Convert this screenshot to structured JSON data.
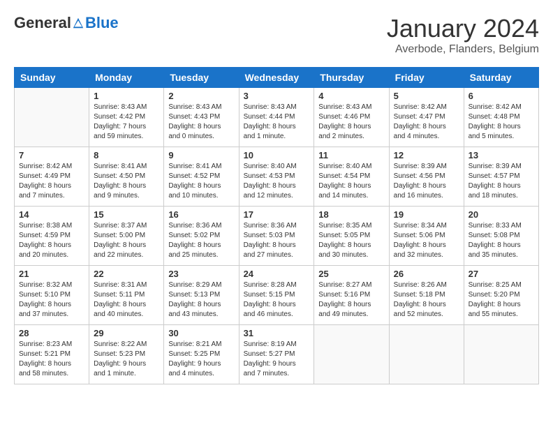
{
  "logo": {
    "general": "General",
    "blue": "Blue"
  },
  "header": {
    "month": "January 2024",
    "location": "Averbode, Flanders, Belgium"
  },
  "weekdays": [
    "Sunday",
    "Monday",
    "Tuesday",
    "Wednesday",
    "Thursday",
    "Friday",
    "Saturday"
  ],
  "weeks": [
    [
      {
        "day": "",
        "info": ""
      },
      {
        "day": "1",
        "info": "Sunrise: 8:43 AM\nSunset: 4:42 PM\nDaylight: 7 hours\nand 59 minutes."
      },
      {
        "day": "2",
        "info": "Sunrise: 8:43 AM\nSunset: 4:43 PM\nDaylight: 8 hours\nand 0 minutes."
      },
      {
        "day": "3",
        "info": "Sunrise: 8:43 AM\nSunset: 4:44 PM\nDaylight: 8 hours\nand 1 minute."
      },
      {
        "day": "4",
        "info": "Sunrise: 8:43 AM\nSunset: 4:46 PM\nDaylight: 8 hours\nand 2 minutes."
      },
      {
        "day": "5",
        "info": "Sunrise: 8:42 AM\nSunset: 4:47 PM\nDaylight: 8 hours\nand 4 minutes."
      },
      {
        "day": "6",
        "info": "Sunrise: 8:42 AM\nSunset: 4:48 PM\nDaylight: 8 hours\nand 5 minutes."
      }
    ],
    [
      {
        "day": "7",
        "info": "Sunrise: 8:42 AM\nSunset: 4:49 PM\nDaylight: 8 hours\nand 7 minutes."
      },
      {
        "day": "8",
        "info": "Sunrise: 8:41 AM\nSunset: 4:50 PM\nDaylight: 8 hours\nand 9 minutes."
      },
      {
        "day": "9",
        "info": "Sunrise: 8:41 AM\nSunset: 4:52 PM\nDaylight: 8 hours\nand 10 minutes."
      },
      {
        "day": "10",
        "info": "Sunrise: 8:40 AM\nSunset: 4:53 PM\nDaylight: 8 hours\nand 12 minutes."
      },
      {
        "day": "11",
        "info": "Sunrise: 8:40 AM\nSunset: 4:54 PM\nDaylight: 8 hours\nand 14 minutes."
      },
      {
        "day": "12",
        "info": "Sunrise: 8:39 AM\nSunset: 4:56 PM\nDaylight: 8 hours\nand 16 minutes."
      },
      {
        "day": "13",
        "info": "Sunrise: 8:39 AM\nSunset: 4:57 PM\nDaylight: 8 hours\nand 18 minutes."
      }
    ],
    [
      {
        "day": "14",
        "info": "Sunrise: 8:38 AM\nSunset: 4:59 PM\nDaylight: 8 hours\nand 20 minutes."
      },
      {
        "day": "15",
        "info": "Sunrise: 8:37 AM\nSunset: 5:00 PM\nDaylight: 8 hours\nand 22 minutes."
      },
      {
        "day": "16",
        "info": "Sunrise: 8:36 AM\nSunset: 5:02 PM\nDaylight: 8 hours\nand 25 minutes."
      },
      {
        "day": "17",
        "info": "Sunrise: 8:36 AM\nSunset: 5:03 PM\nDaylight: 8 hours\nand 27 minutes."
      },
      {
        "day": "18",
        "info": "Sunrise: 8:35 AM\nSunset: 5:05 PM\nDaylight: 8 hours\nand 30 minutes."
      },
      {
        "day": "19",
        "info": "Sunrise: 8:34 AM\nSunset: 5:06 PM\nDaylight: 8 hours\nand 32 minutes."
      },
      {
        "day": "20",
        "info": "Sunrise: 8:33 AM\nSunset: 5:08 PM\nDaylight: 8 hours\nand 35 minutes."
      }
    ],
    [
      {
        "day": "21",
        "info": "Sunrise: 8:32 AM\nSunset: 5:10 PM\nDaylight: 8 hours\nand 37 minutes."
      },
      {
        "day": "22",
        "info": "Sunrise: 8:31 AM\nSunset: 5:11 PM\nDaylight: 8 hours\nand 40 minutes."
      },
      {
        "day": "23",
        "info": "Sunrise: 8:29 AM\nSunset: 5:13 PM\nDaylight: 8 hours\nand 43 minutes."
      },
      {
        "day": "24",
        "info": "Sunrise: 8:28 AM\nSunset: 5:15 PM\nDaylight: 8 hours\nand 46 minutes."
      },
      {
        "day": "25",
        "info": "Sunrise: 8:27 AM\nSunset: 5:16 PM\nDaylight: 8 hours\nand 49 minutes."
      },
      {
        "day": "26",
        "info": "Sunrise: 8:26 AM\nSunset: 5:18 PM\nDaylight: 8 hours\nand 52 minutes."
      },
      {
        "day": "27",
        "info": "Sunrise: 8:25 AM\nSunset: 5:20 PM\nDaylight: 8 hours\nand 55 minutes."
      }
    ],
    [
      {
        "day": "28",
        "info": "Sunrise: 8:23 AM\nSunset: 5:21 PM\nDaylight: 8 hours\nand 58 minutes."
      },
      {
        "day": "29",
        "info": "Sunrise: 8:22 AM\nSunset: 5:23 PM\nDaylight: 9 hours\nand 1 minute."
      },
      {
        "day": "30",
        "info": "Sunrise: 8:21 AM\nSunset: 5:25 PM\nDaylight: 9 hours\nand 4 minutes."
      },
      {
        "day": "31",
        "info": "Sunrise: 8:19 AM\nSunset: 5:27 PM\nDaylight: 9 hours\nand 7 minutes."
      },
      {
        "day": "",
        "info": ""
      },
      {
        "day": "",
        "info": ""
      },
      {
        "day": "",
        "info": ""
      }
    ]
  ]
}
